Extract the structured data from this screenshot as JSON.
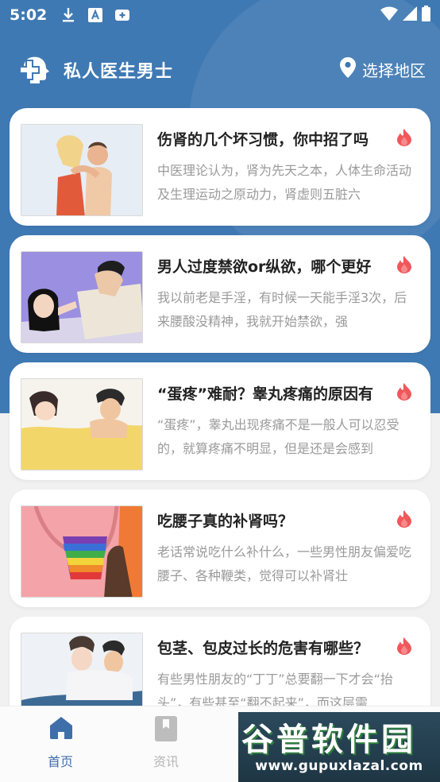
{
  "status_bar": {
    "time": "5:02"
  },
  "header": {
    "title": "私人医生男士",
    "region_label": "选择地区"
  },
  "articles": [
    {
      "title": "伤肾的几个坏习惯，你中招了吗",
      "desc": "中医理论认为，肾为先天之本，人体生命活动及生理运动之原动力，肾虚则五脏六"
    },
    {
      "title": "男人过度禁欲or纵欲，哪个更好",
      "desc": "我以前老是手淫，有时候一天能手淫3次，后来腰酸没精神，我就开始禁欲，强"
    },
    {
      "title": "“蛋疼”难耐？睾丸疼痛的原因有",
      "desc": "“蛋疼”，睾丸出现疼痛不是一般人可以忍受的，就算疼痛不明显，但是还是会感到"
    },
    {
      "title": "吃腰子真的补肾吗？",
      "desc": "老话常说吃什么补什么，一些男性朋友偏爱吃腰子、各种鞭类，觉得可以补肾壮"
    },
    {
      "title": "包茎、包皮过长的危害有哪些？",
      "desc": "有些男性朋友的“丁丁”总要翻一下才会“抬头”，有些甚至“翻不起来”，而这层需"
    }
  ],
  "tabbar": {
    "home_label": "首页",
    "news_label": "资讯",
    "active_color": "#3f6fa8",
    "inactive_color": "#b5b5b5"
  },
  "watermark": {
    "main": "谷普软件园",
    "url": "www.gupuxlazal.com"
  },
  "colors": {
    "header_bg": "#3f79b3",
    "flame": "#f0575b",
    "card_bg": "#ffffff"
  }
}
